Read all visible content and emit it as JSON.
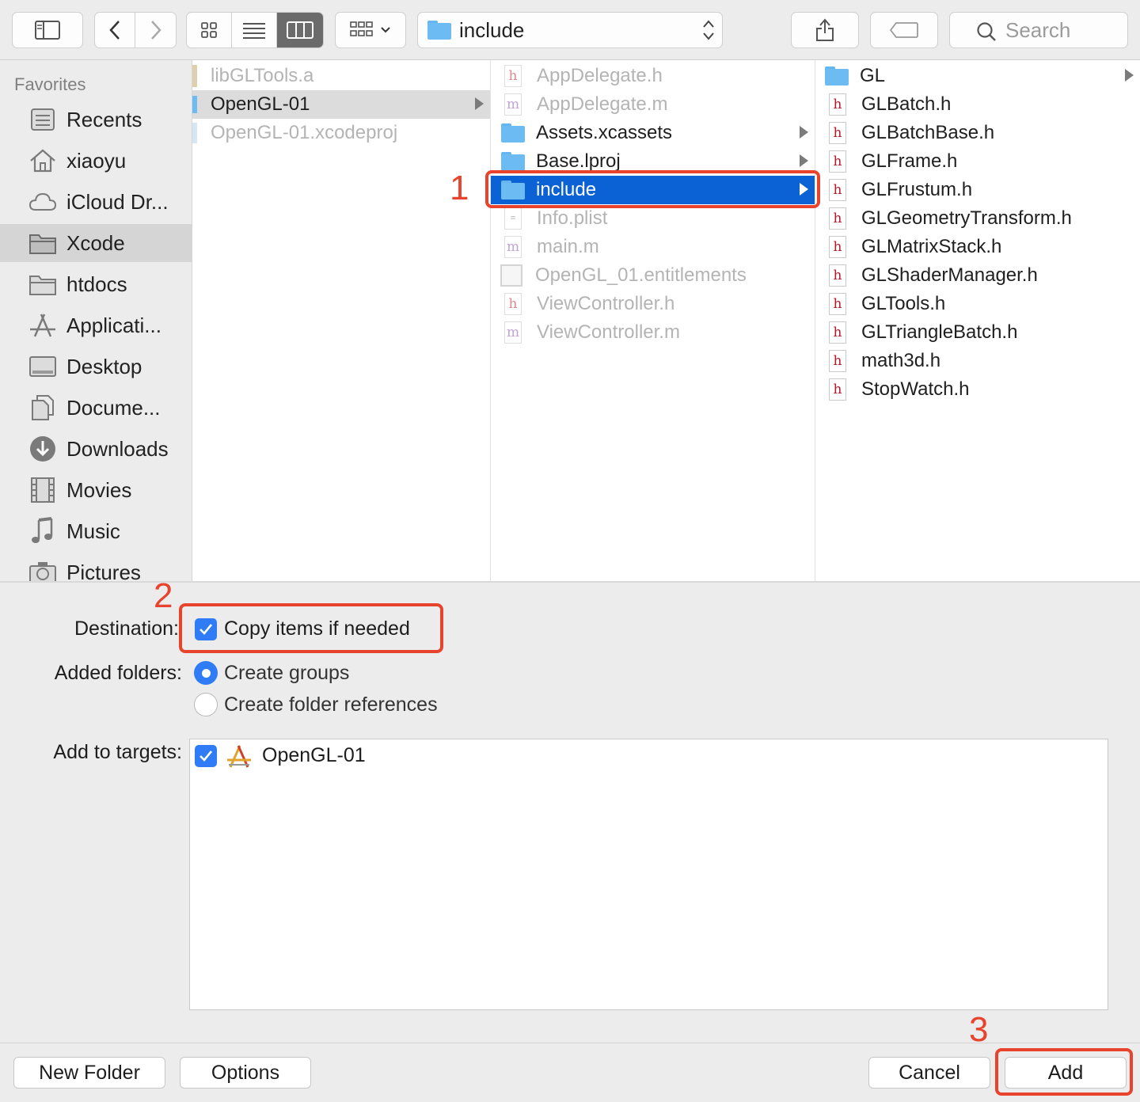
{
  "toolbar": {
    "path_label": "include",
    "search_placeholder": "Search"
  },
  "sidebar": {
    "header": "Favorites",
    "items": [
      {
        "label": "Recents",
        "icon": "recents-icon"
      },
      {
        "label": "xiaoyu",
        "icon": "home-icon"
      },
      {
        "label": "iCloud Dr...",
        "icon": "cloud-icon"
      },
      {
        "label": "Xcode",
        "icon": "folder-icon",
        "selected": true
      },
      {
        "label": "htdocs",
        "icon": "folder-icon"
      },
      {
        "label": "Applicati...",
        "icon": "applications-icon"
      },
      {
        "label": "Desktop",
        "icon": "desktop-icon"
      },
      {
        "label": "Docume...",
        "icon": "documents-icon"
      },
      {
        "label": "Downloads",
        "icon": "downloads-icon"
      },
      {
        "label": "Movies",
        "icon": "movies-icon"
      },
      {
        "label": "Music",
        "icon": "music-icon"
      },
      {
        "label": "Pictures",
        "icon": "camera-icon"
      }
    ]
  },
  "columns": {
    "col1": [
      {
        "label": "libGLTools.a",
        "dim": true
      },
      {
        "label": "OpenGL-01",
        "selected": true
      },
      {
        "label": "OpenGL-01.xcodeproj",
        "dim": true
      }
    ],
    "col2": [
      {
        "label": "AppDelegate.h",
        "dim": true
      },
      {
        "label": "AppDelegate.m",
        "dim": true
      },
      {
        "label": "Assets.xcassets"
      },
      {
        "label": "Base.lproj"
      },
      {
        "label": "include",
        "selected": true
      },
      {
        "label": "Info.plist",
        "dim": true
      },
      {
        "label": "main.m",
        "dim": true
      },
      {
        "label": "OpenGL_01.entitlements",
        "dim": true
      },
      {
        "label": "ViewController.h",
        "dim": true
      },
      {
        "label": "ViewController.m",
        "dim": true
      }
    ],
    "col3": [
      {
        "label": "GL"
      },
      {
        "label": "GLBatch.h"
      },
      {
        "label": "GLBatchBase.h"
      },
      {
        "label": "GLFrame.h"
      },
      {
        "label": "GLFrustum.h"
      },
      {
        "label": "GLGeometryTransform.h"
      },
      {
        "label": "GLMatrixStack.h"
      },
      {
        "label": "GLShaderManager.h"
      },
      {
        "label": "GLTools.h"
      },
      {
        "label": "GLTriangleBatch.h"
      },
      {
        "label": "math3d.h"
      },
      {
        "label": "StopWatch.h"
      }
    ]
  },
  "options": {
    "destination_label": "Destination:",
    "copy_items_label": "Copy items if needed",
    "copy_items_checked": true,
    "added_folders_label": "Added folders:",
    "create_groups_label": "Create groups",
    "create_folder_refs_label": "Create folder references",
    "selected_folder_option": "Create groups",
    "add_to_targets_label": "Add to targets:",
    "target_name": "OpenGL-01",
    "target_checked": true
  },
  "buttons": {
    "new_folder": "New Folder",
    "options": "Options",
    "cancel": "Cancel",
    "add": "Add"
  },
  "annotations": {
    "step1": "1",
    "step2": "2",
    "step3": "3",
    "color": "#e8432d"
  },
  "colors": {
    "accent": "#2f7cf6",
    "selection": "#0b62d4",
    "header_icon_red": "#b5182b",
    "impl_icon_purple": "#8b55b0"
  }
}
